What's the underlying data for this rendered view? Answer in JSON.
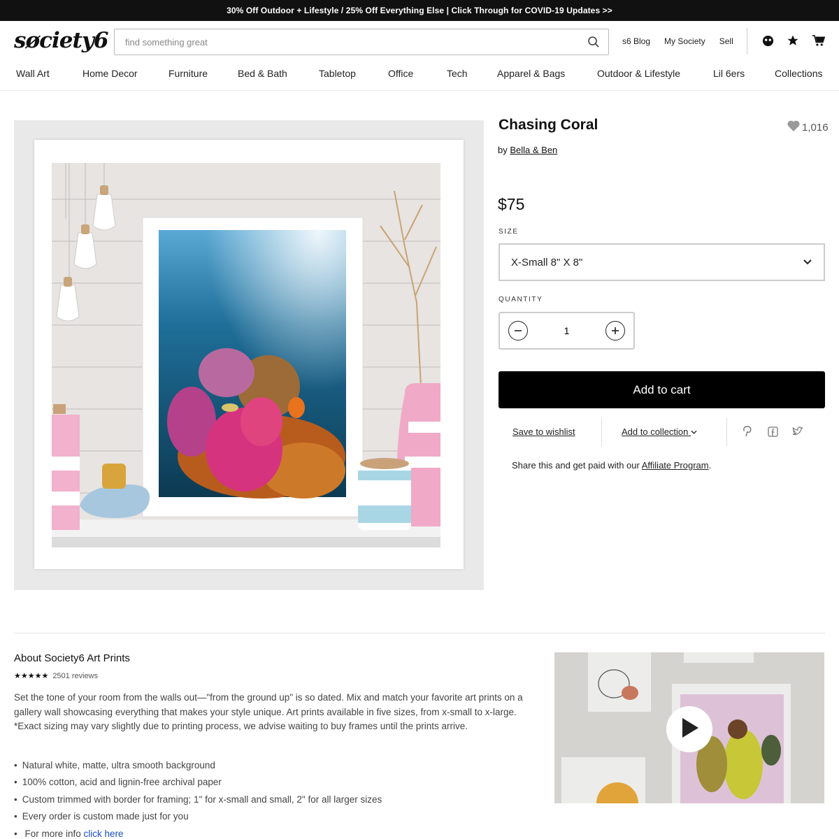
{
  "promo": {
    "text": "30% Off Outdoor + Lifestyle / 25% Off Everything Else | Click Through for COVID-19 Updates >>"
  },
  "header": {
    "logo": "søciety6",
    "search_placeholder": "find something great",
    "links": [
      "s6 Blog",
      "My Society",
      "Sell"
    ],
    "icons": [
      "account-icon",
      "star-icon",
      "cart-icon"
    ]
  },
  "nav": [
    "Wall Art",
    "Home Decor",
    "Furniture",
    "Bed & Bath",
    "Tabletop",
    "Office",
    "Tech",
    "Apparel & Bags",
    "Outdoor & Lifestyle",
    "Lil 6ers",
    "Collections"
  ],
  "product": {
    "title": "Chasing Coral",
    "favorites": "1,016",
    "by_prefix": "by",
    "artist": "Bella & Ben",
    "price": "$75",
    "size_label": "SIZE",
    "size_value": "X-Small 8\" X 8\"",
    "quantity_label": "QUANTITY",
    "quantity": "1",
    "add_to_cart": "Add to cart",
    "save_wishlist": "Save to wishlist",
    "add_collection": "Add to collection",
    "share_text": "Share this and get paid with our",
    "affiliate_link": "Affiliate Program",
    "share_icons": [
      "pinterest-icon",
      "facebook-icon",
      "twitter-icon"
    ]
  },
  "about": {
    "title": "About Society6 Art Prints",
    "stars": "★★★★★",
    "reviews": "2501 reviews",
    "description": "Set the tone of your room from the walls out—\"from the ground up\" is so dated. Mix and match your favorite art prints on a gallery wall showcasing everything that makes your style unique. Art prints available in five sizes, from x-small to x-large. *Exact sizing may vary slightly due to printing process, we advise waiting to buy frames until the prints arrive.",
    "bullets": [
      "Natural white, matte, ultra smooth background",
      "100% cotton, acid and lignin-free archival paper",
      "Custom trimmed with border for framing; 1\" for x-small and small, 2\" for all larger sizes",
      "Every order is custom made just for you"
    ],
    "more_info_text": "For more info",
    "more_info_link": "click here"
  },
  "colors": {
    "accent": "#000000",
    "link_blue": "#1a4fc4",
    "promo_bg": "#111111"
  }
}
